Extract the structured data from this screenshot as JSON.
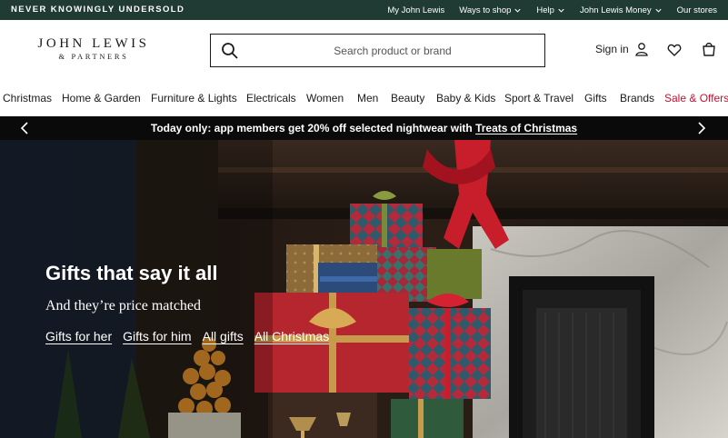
{
  "topbar": {
    "tagline": "NEVER KNOWINGLY UNDERSOLD",
    "links": [
      {
        "label": "My John Lewis",
        "has_menu": false
      },
      {
        "label": "Ways to shop",
        "has_menu": true
      },
      {
        "label": "Help",
        "has_menu": true
      },
      {
        "label": "John Lewis Money",
        "has_menu": true
      },
      {
        "label": "Our stores",
        "has_menu": false
      }
    ]
  },
  "header": {
    "logo_line1": "JOHN LEWIS",
    "logo_line2": "& PARTNERS",
    "search_placeholder": "Search product or brand",
    "sign_in": "Sign in",
    "icons": [
      "search-icon",
      "user-icon",
      "heart-icon",
      "basket-icon"
    ]
  },
  "nav": {
    "items": [
      "Christmas",
      "Home & Garden",
      "Furniture & Lights",
      "Electricals",
      "Women",
      "Men",
      "Beauty",
      "Baby & Kids",
      "Sport & Travel",
      "Gifts",
      "Brands",
      "Sale & Offers"
    ]
  },
  "promo": {
    "text": "Today only: app members get 20% off selected nightwear with ",
    "link": "Treats of Christmas"
  },
  "hero": {
    "headline": "Gifts that say it all",
    "subline": "And they’re price matched",
    "links": [
      "Gifts for her",
      "Gifts for him",
      "All gifts",
      "All Christmas"
    ]
  },
  "colors": {
    "topbar_bg": "#1f3b33",
    "promo_bg": "#0a0a0a",
    "sale_red": "#c8102e"
  }
}
